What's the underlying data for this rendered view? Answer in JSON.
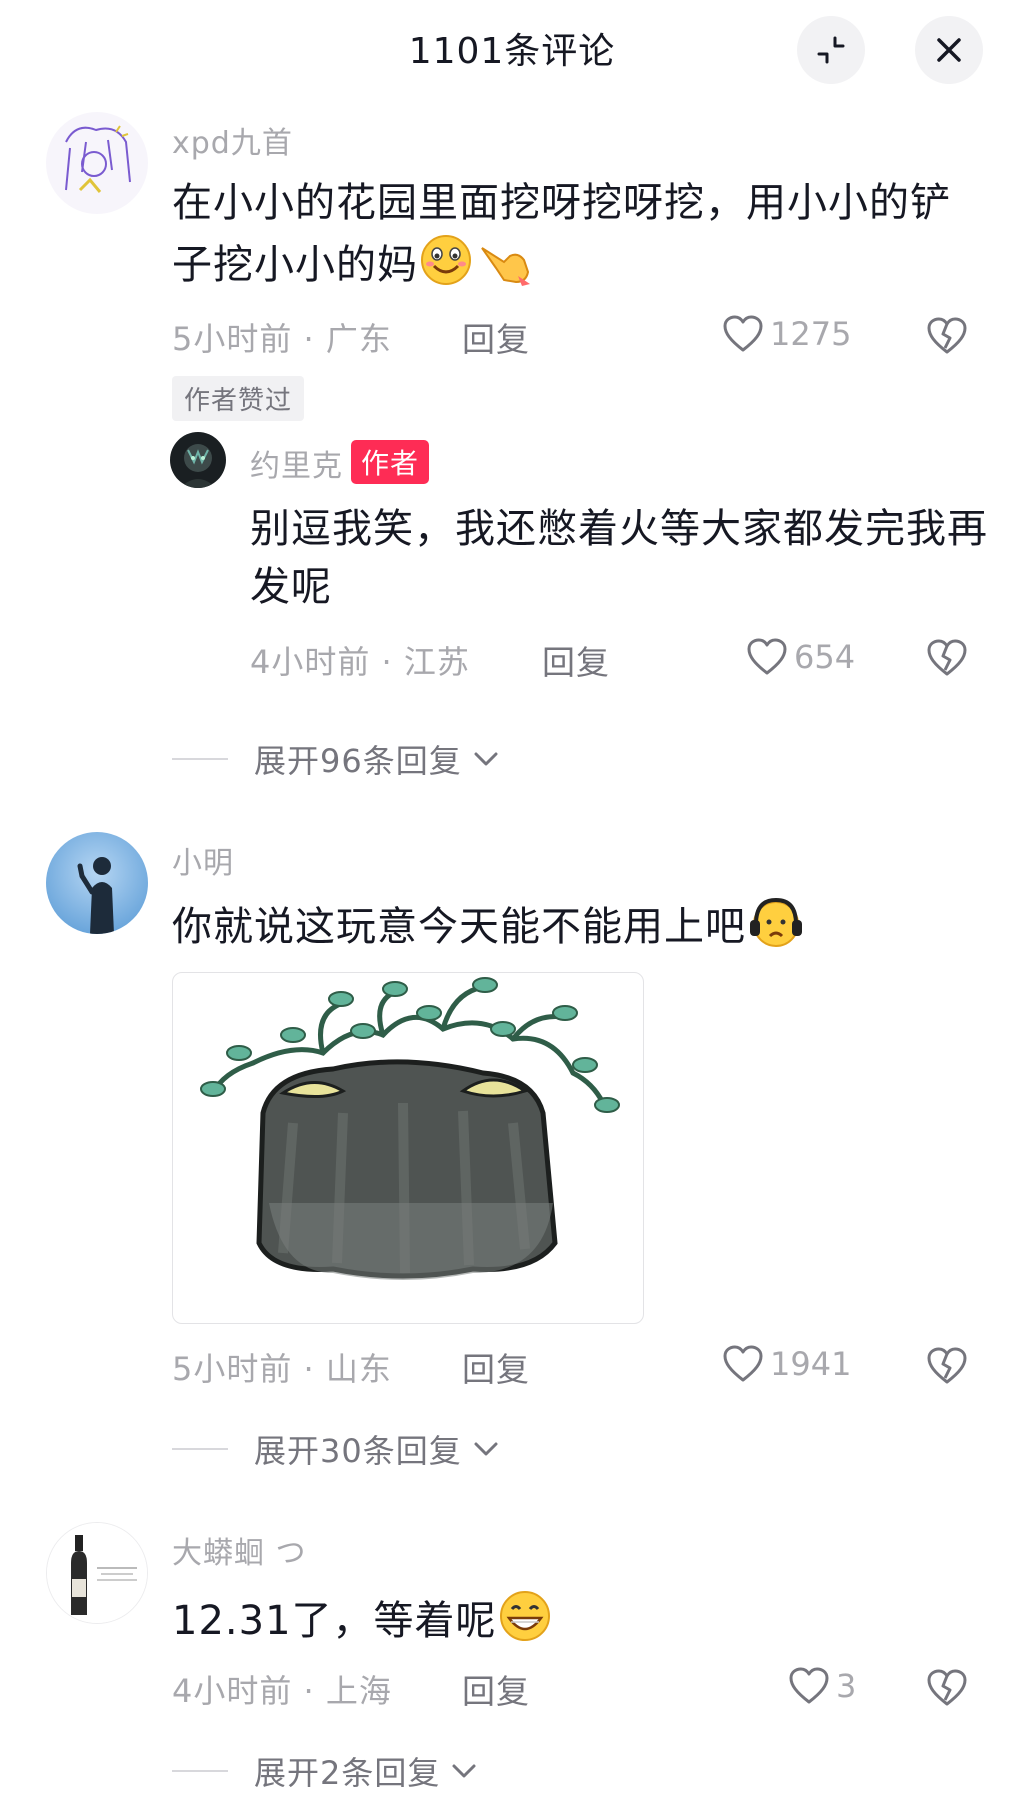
{
  "header": {
    "title": "1101条评论"
  },
  "comments": [
    {
      "username": "xpd九首",
      "text": "在小小的花园里面挖呀挖呀挖，用小小的铲子挖小小的妈",
      "time_location": "5小时前 · 广东",
      "reply_label": "回复",
      "likes": "1275",
      "liked_tag": "作者赞过",
      "sub_reply": {
        "username": "约里克",
        "badge": "作者",
        "text": "别逗我笑，我还憋着火等大家都发完我再发呢",
        "time_location": "4小时前 · 江苏",
        "reply_label": "回复",
        "likes": "654"
      },
      "expand_label": "展开96条回复"
    },
    {
      "username": "小明",
      "text": "你就说这玩意今天能不能用上吧",
      "time_location": "5小时前 · 山东",
      "reply_label": "回复",
      "likes": "1941",
      "expand_label": "展开30条回复"
    },
    {
      "username": "大蟒蛔 つ",
      "text": "12.31了，等着呢",
      "time_location": "4小时前 · 上海",
      "reply_label": "回复",
      "likes": "3",
      "expand_label": "展开2条回复"
    }
  ],
  "icons": {
    "collapse": "collapse-icon",
    "close": "close-icon",
    "like": "heart-icon",
    "dislike": "broken-heart-icon",
    "expand": "chevron-down-icon"
  },
  "colors": {
    "author_badge": "#fe2c55",
    "meta_gray": "#a8a8ad"
  }
}
